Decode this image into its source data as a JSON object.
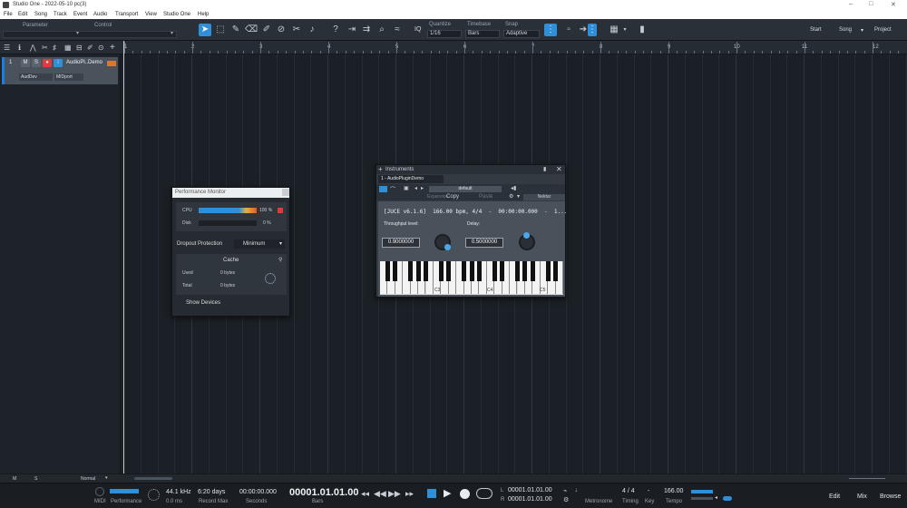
{
  "window": {
    "title": "Studio One - 2022-05-10 pc(3)"
  },
  "menu": [
    "File",
    "Edit",
    "Song",
    "Track",
    "Event",
    "Audio",
    "Transport",
    "View",
    "Studio One",
    "Help"
  ],
  "toolbar": {
    "parameter_label": "Parameter",
    "control_label": "Control",
    "quantize_label": "Quantize",
    "quantize_value": "1/16",
    "timebase_label": "Timebase",
    "timebase_value": "Bars",
    "snap_label": "Snap",
    "snap_value": "Adaptive",
    "iq_label": "IQ",
    "start_label": "Start",
    "song_label": "Song",
    "project_label": "Project"
  },
  "ruler": {
    "bars": [
      "1",
      "2",
      "3",
      "4",
      "5",
      "6",
      "7",
      "8",
      "9",
      "10",
      "11",
      "12"
    ]
  },
  "track": {
    "number": "1",
    "mute": "M",
    "solo": "S",
    "name": "AudioPl..Demo",
    "input": "AudDev",
    "output": "MIDport"
  },
  "perf_monitor": {
    "title": "Performance Monitor",
    "cpu_label": "CPU",
    "cpu_value": "100 %",
    "cpu_level": 1.0,
    "disk_label": "Disk",
    "disk_value": "0 %",
    "dropout_label": "Dropout Protection",
    "dropout_value": "Minimum",
    "cache_title": "Cache",
    "used_label": "Used",
    "used_value": "0 bytes",
    "total_label": "Total",
    "total_value": "0 bytes",
    "show_devices": "Show Devices"
  },
  "instrument": {
    "title": "Instruments",
    "tab_label": "1 - AudioPluginDemo",
    "preset": "default",
    "copy": "Copy",
    "paste": "Paste",
    "nektar": "Nektar",
    "info_line": "[JUCE v6.1.6]  166.00 bpm, 4/4  -  00:00:00.000  -  1...",
    "throughput_label": "Throughput level:",
    "throughput_value": "0.9000000",
    "delay_label": "Delay:",
    "delay_value": "0.5000000",
    "key_c3": "C3",
    "key_c4": "C4",
    "key_c5": "C5"
  },
  "bottombar": {
    "m": "M",
    "s": "S",
    "mode": "Normal"
  },
  "transport": {
    "midi": "MIDI",
    "performance": "Performance",
    "sample_rate": "44.1 kHz",
    "latency": "0.0 ms",
    "record_days": "6:20 days",
    "record_label": "Record Max",
    "seconds_value": "00:00:00.000",
    "seconds_label": "Seconds",
    "position": "00001.01.01.00",
    "position_label": "Bars",
    "loop_start": "00001.01.01.00",
    "loop_end": "00001.01.01.00",
    "loop_l": "L",
    "loop_r": "R",
    "metronome_label": "Metronome",
    "time_sig": "4 / 4",
    "timing_label": "Timing",
    "key_label": "Key",
    "tempo_value": "166.00",
    "tempo_label": "Tempo",
    "edit": "Edit",
    "mix": "Mix",
    "browse": "Browse"
  },
  "colors": {
    "accent": "#2f8fd8",
    "record": "#e03a3a",
    "track_bar": "#1c7fe0"
  }
}
